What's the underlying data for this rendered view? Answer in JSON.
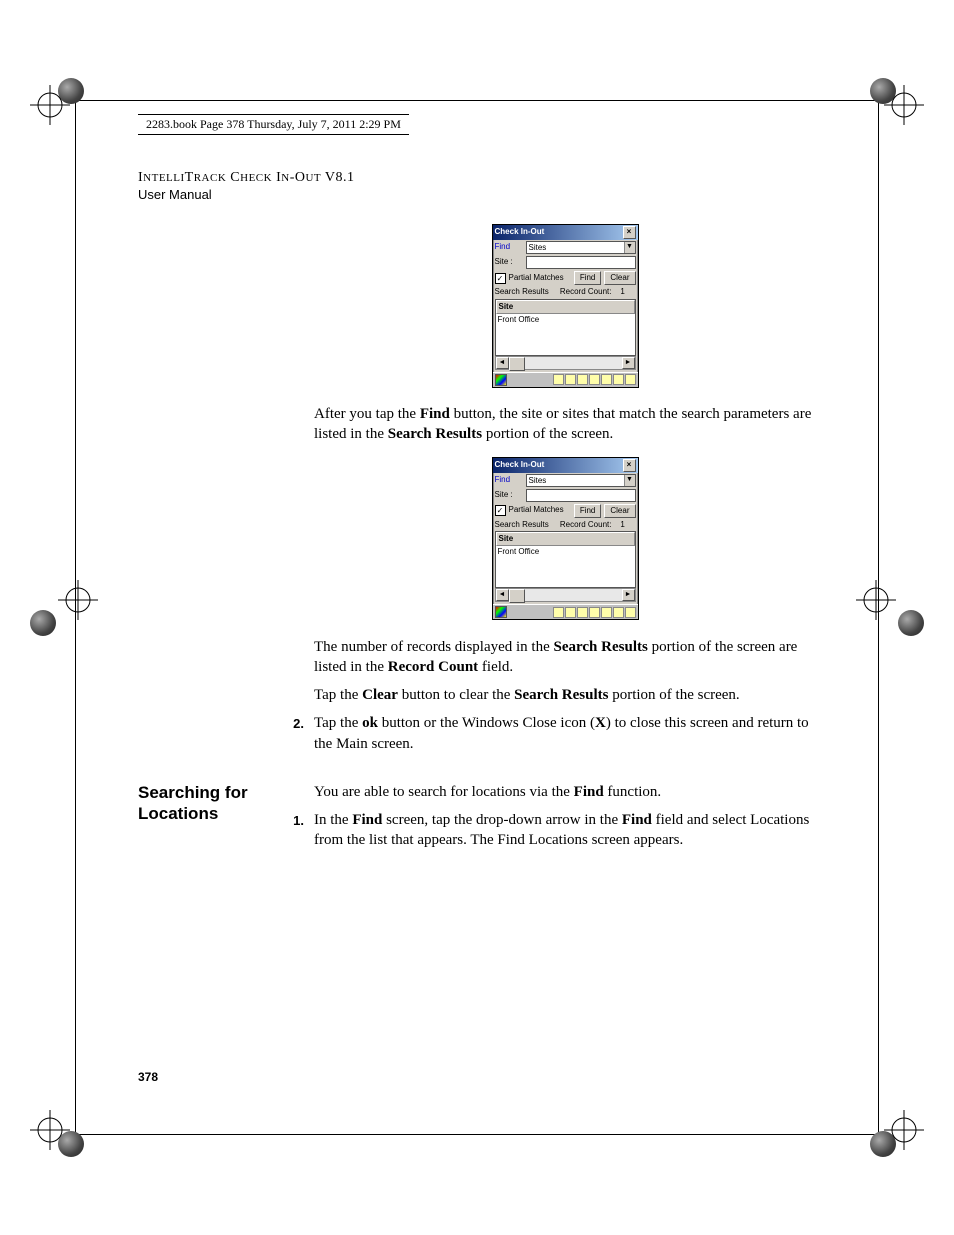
{
  "header_line": "2283.book  Page 378  Thursday, July 7, 2011  2:29 PM",
  "doc_title_a": "I",
  "doc_title_b": "NTELLI",
  "doc_title_c": "T",
  "doc_title_d": "RACK",
  "doc_title_e": " C",
  "doc_title_f": "HECK",
  "doc_title_g": " I",
  "doc_title_h": "N",
  "doc_title_i": "-O",
  "doc_title_j": "UT",
  "doc_title_k": " V8.1",
  "doc_subtitle": "User Manual",
  "para1_a": "After you tap the ",
  "para1_b": "Find",
  "para1_c": " button, the site or sites that match the search parameters are listed in the ",
  "para1_d": "Search Results",
  "para1_e": " portion of the screen.",
  "para2_a": "The number of records displayed in the ",
  "para2_b": "Search Results",
  "para2_c": " portion of the screen are listed in the ",
  "para2_d": "Record Count",
  "para2_e": " field.",
  "para3_a": "Tap the ",
  "para3_b": "Clear",
  "para3_c": " button to clear the ",
  "para3_d": "Search Results",
  "para3_e": " portion of the screen.",
  "step2_num": "2.",
  "step2_a": "Tap the ",
  "step2_b": "ok",
  "step2_c": " button or the Windows Close icon (",
  "step2_d": "X",
  "step2_e": ") to close this screen and return to the Main screen.",
  "side_heading": "Searching for Locations",
  "para4_a": "You are able to search for locations via the ",
  "para4_b": "Find",
  "para4_c": " function.",
  "step1b_num": "1.",
  "step1b_a": "In the ",
  "step1b_b": "Find",
  "step1b_c": " screen, tap the drop-down arrow in the ",
  "step1b_d": "Find",
  "step1b_e": " field and select Locations from the list that appears. The Find Locations screen appears.",
  "page_number": "378",
  "shot": {
    "title": "Check In-Out",
    "close": "×",
    "find_lbl": "Find",
    "find_val": "Sites",
    "site_lbl": "Site :",
    "partial": "Partial Matches",
    "check": "✓",
    "find_btn": "Find",
    "clear_btn": "Clear",
    "sr_lbl": "Search Results",
    "rc_lbl": "Record Count:",
    "rc_val": "1",
    "col1": "Site",
    "row1": "Front Office",
    "left": "◄",
    "right": "►",
    "dd": "▼"
  }
}
